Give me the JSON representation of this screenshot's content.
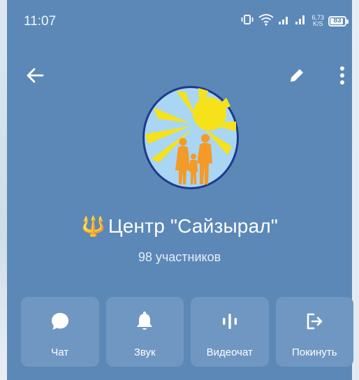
{
  "status_bar": {
    "time": "11:07",
    "net_speed_value": "6,73",
    "net_speed_unit": "K/S",
    "battery_level": "83"
  },
  "toolbar": {
    "back_icon": "arrow-left-icon",
    "edit_icon": "pencil-icon",
    "more_icon": "more-vertical-icon"
  },
  "group": {
    "emoji": "🔱",
    "title": "Центр \"Сайзырал\"",
    "members": "98 участников"
  },
  "actions": [
    {
      "label": "Чат",
      "icon": "chat-bubble-icon"
    },
    {
      "label": "Звук",
      "icon": "bell-icon"
    },
    {
      "label": "Видеочат",
      "icon": "voice-wave-icon"
    },
    {
      "label": "Покинуть",
      "icon": "leave-icon"
    }
  ],
  "colors": {
    "panel_bg": "#5b88b7",
    "button_bg": "#6f97c1",
    "text": "#ffffff",
    "emoji_gold": "#f7c21b"
  }
}
